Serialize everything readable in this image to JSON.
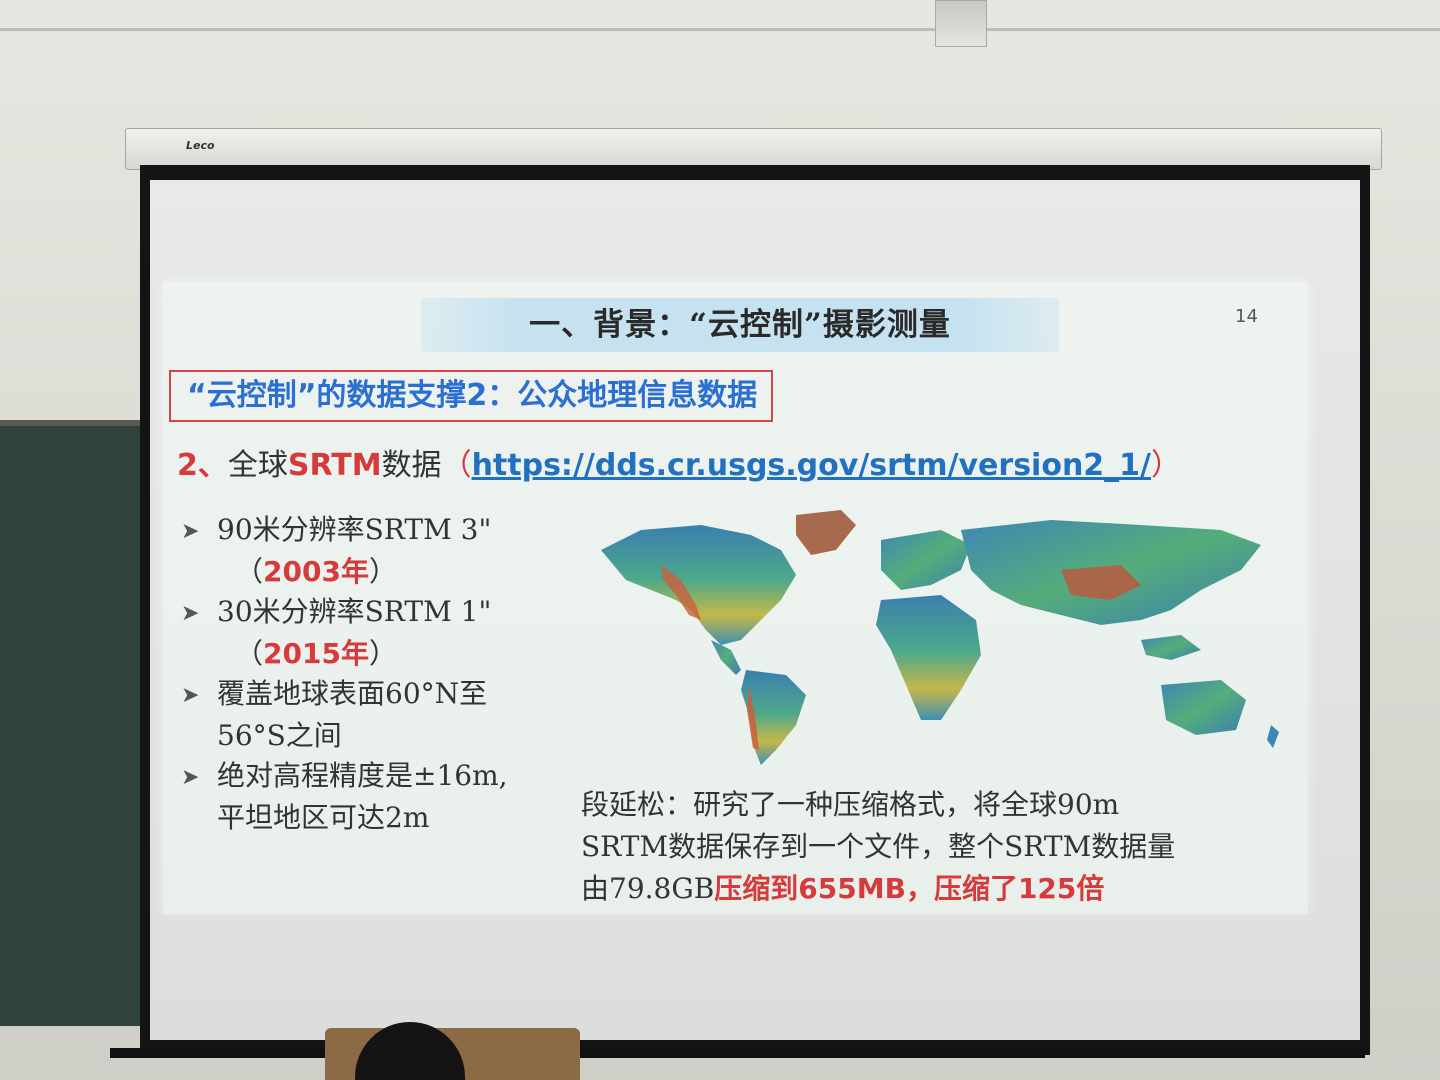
{
  "slide": {
    "title": "一、背景：“云控制”摄影测量",
    "page_number": "14",
    "subtitle": "“云控制”的数据支撑2：公众地理信息数据",
    "heading": {
      "number": "2、",
      "prefix": "全球",
      "srtm": "SRTM",
      "suffix": "数据",
      "paren_open": "（",
      "link": "https://dds.cr.usgs.gov/srtm/version2_1/",
      "paren_close": "）"
    },
    "bullets": [
      {
        "text": "90米分辨率SRTM 3\"",
        "sub_open": "（",
        "sub_year": "2003年",
        "sub_close": "）"
      },
      {
        "text": "30米分辨率SRTM 1\"",
        "sub_open": "（",
        "sub_year": "2015年",
        "sub_close": "）"
      },
      {
        "text": "覆盖地球表面60°N至",
        "cont": "56°S之间"
      },
      {
        "text": "绝对高程精度是±16m,",
        "cont": "平坦地区可达2m"
      }
    ],
    "note": {
      "line1": "段延松：研究了一种压缩格式，将全球90m",
      "line2": "SRTM数据保存到一个文件，整个SRTM数据量",
      "line3_a": "由79.8GB",
      "line3_b": "压缩到655MB，压缩了125倍"
    }
  },
  "projector_screen": {
    "brand": "Leco"
  },
  "colors": {
    "accent_red": "#d63a3a",
    "link_blue": "#2270c0",
    "subtitle_blue": "#2b6fd1",
    "title_band": "#c6e2f0"
  },
  "icons": {
    "bullet": "arrow-bullet-icon",
    "map": "world-elevation-map"
  }
}
